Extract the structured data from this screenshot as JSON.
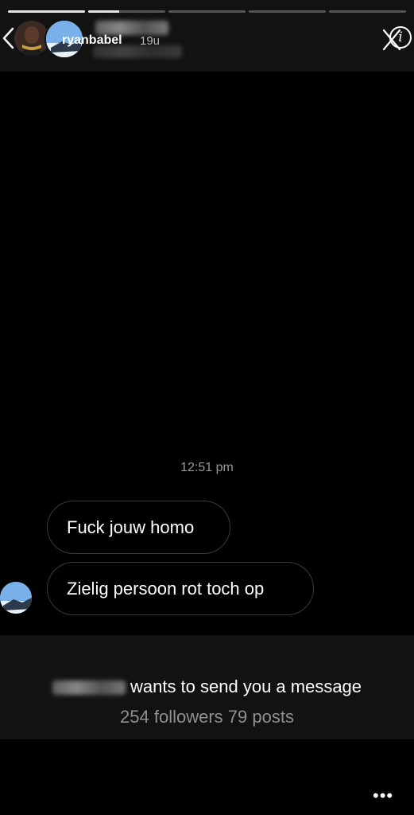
{
  "header": {
    "username": "ryanbabel",
    "time_ago": "19u",
    "progress": [
      1.0,
      0.4,
      0.0,
      0.0,
      0.0
    ]
  },
  "icons": {
    "back": "chevron-left-icon",
    "close": "close-icon",
    "info": "info-icon",
    "info_glyph": "i",
    "more": "more-horizontal-icon",
    "more_glyph": "•••"
  },
  "chat": {
    "timestamp": "12:51 pm",
    "messages": [
      {
        "text": "Fuck jouw homo"
      },
      {
        "text": "Zielig persoon rot toch op"
      }
    ]
  },
  "request": {
    "message": "wants to send you a message",
    "stats": "254 followers 79 posts"
  },
  "colors": {
    "background": "#000000",
    "header_bg": "#121212",
    "bubble_border": "#3a3a3a",
    "muted_text": "#9a9a9a"
  }
}
